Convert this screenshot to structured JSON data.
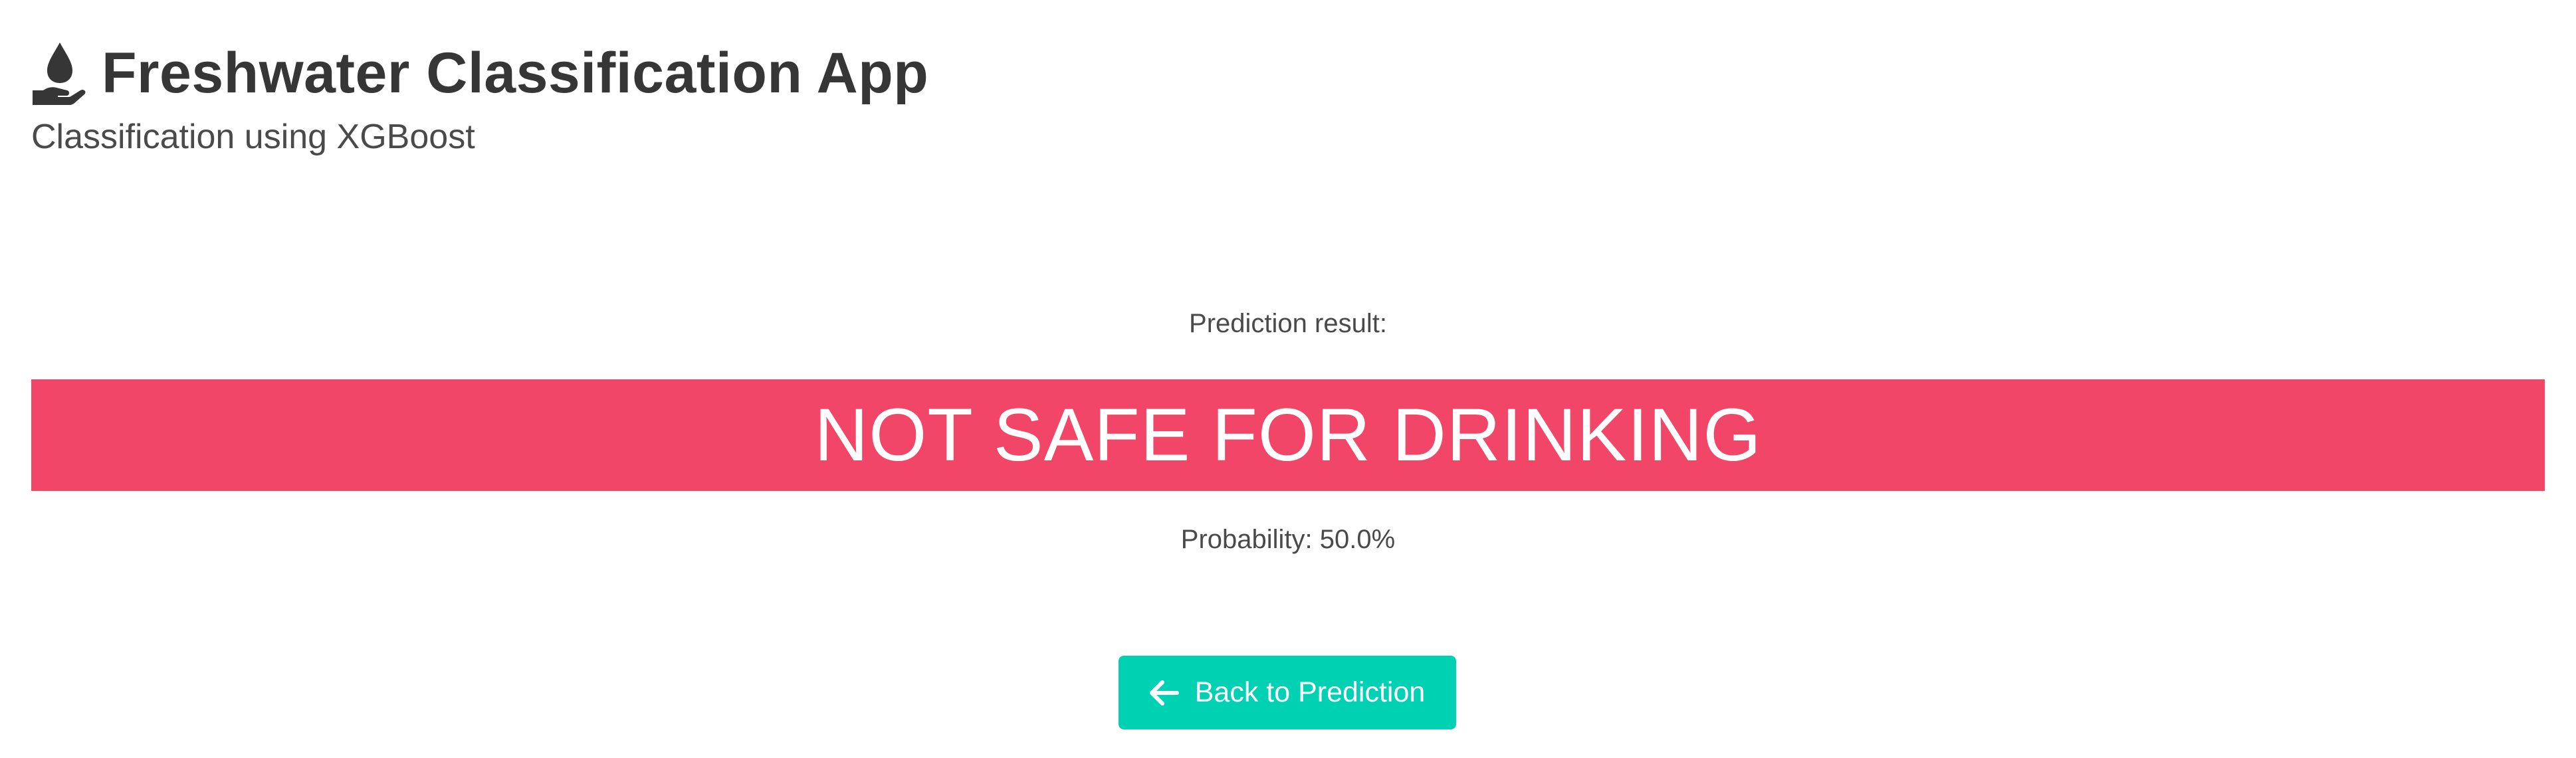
{
  "header": {
    "title": "Freshwater Classification App",
    "subtitle": "Classification using XGBoost",
    "icon": "hand-holding-water-icon"
  },
  "result": {
    "label": "Prediction result:",
    "prediction": "NOT SAFE FOR DRINKING",
    "probability_text": "Probability: 50.0%",
    "probability": 0.5
  },
  "actions": {
    "back_label": "Back to Prediction",
    "back_icon": "arrow-left-icon"
  },
  "colors": {
    "danger": "#f14668",
    "primary": "#00d1b2",
    "text": "#363636"
  }
}
